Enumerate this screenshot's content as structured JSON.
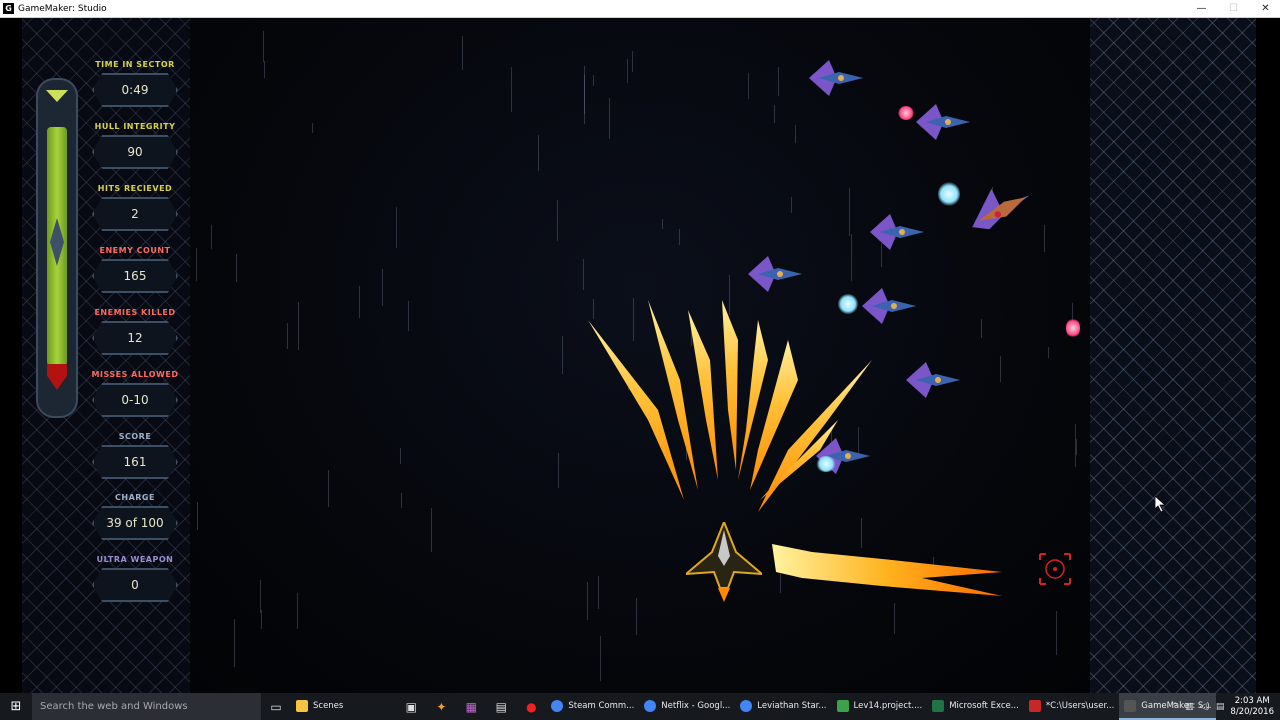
{
  "window": {
    "title": "GameMaker: Studio",
    "icon": "gamemaker-icon",
    "min_glyph": "—",
    "max_glyph": "☐",
    "close_glyph": "✕"
  },
  "hud": {
    "stats": [
      {
        "label": "TIME IN SECTOR",
        "value": "0:49",
        "color": "#d8d24a"
      },
      {
        "label": "HULL INTEGRITY",
        "value": "90",
        "color": "#d8d24a"
      },
      {
        "label": "HITS RECIEVED",
        "value": "2",
        "color": "#d8d24a"
      },
      {
        "label": "ENEMY COUNT",
        "value": "165",
        "color": "#ff6b5e"
      },
      {
        "label": "ENEMIES KILLED",
        "value": "12",
        "color": "#ff6b5e"
      },
      {
        "label": "MISSES ALLOWED",
        "value": "0-10",
        "color": "#ff6b5e"
      },
      {
        "label": "SCORE",
        "value": "161",
        "color": "#9fb0c8"
      },
      {
        "label": "CHARGE",
        "value": "39 of 100",
        "color": "#9fb0c8"
      },
      {
        "label": "ULTRA WEAPON",
        "value": "0",
        "color": "#9b8ed6"
      }
    ],
    "health_fraction": 0.9
  },
  "colors": {
    "enemy_wing": "#7a56c8",
    "enemy_body": "#3b63b0",
    "fire": "#ffb02a",
    "orb_pink": "#ff3f7e",
    "orb_cyan": "#8fe3ff",
    "reticle": "#d82020"
  },
  "taskbar": {
    "search_placeholder": "Search the web and Windows",
    "apps": [
      {
        "label": "Scenes",
        "icon": "folder-icon",
        "color": "#f3c341"
      },
      {
        "label": "Steam Comm...",
        "icon": "chrome-icon",
        "color": "#4285f4"
      },
      {
        "label": "Netflix - Googl...",
        "icon": "chrome-icon",
        "color": "#4285f4"
      },
      {
        "label": "Leviathan Star...",
        "icon": "chrome-icon",
        "color": "#4285f4"
      },
      {
        "label": "Lev14.project....",
        "icon": "gamemaker-icon",
        "color": "#3aa24a"
      },
      {
        "label": "Microsoft Exce...",
        "icon": "excel-icon",
        "color": "#217346"
      },
      {
        "label": "*C:\\Users\\user...",
        "icon": "notepad-icon",
        "color": "#c62828"
      },
      {
        "label": "GameMaker: S...",
        "icon": "gamemaker-icon",
        "color": "#555",
        "active": true
      }
    ],
    "time": "2:03 AM",
    "date": "8/20/2016"
  }
}
